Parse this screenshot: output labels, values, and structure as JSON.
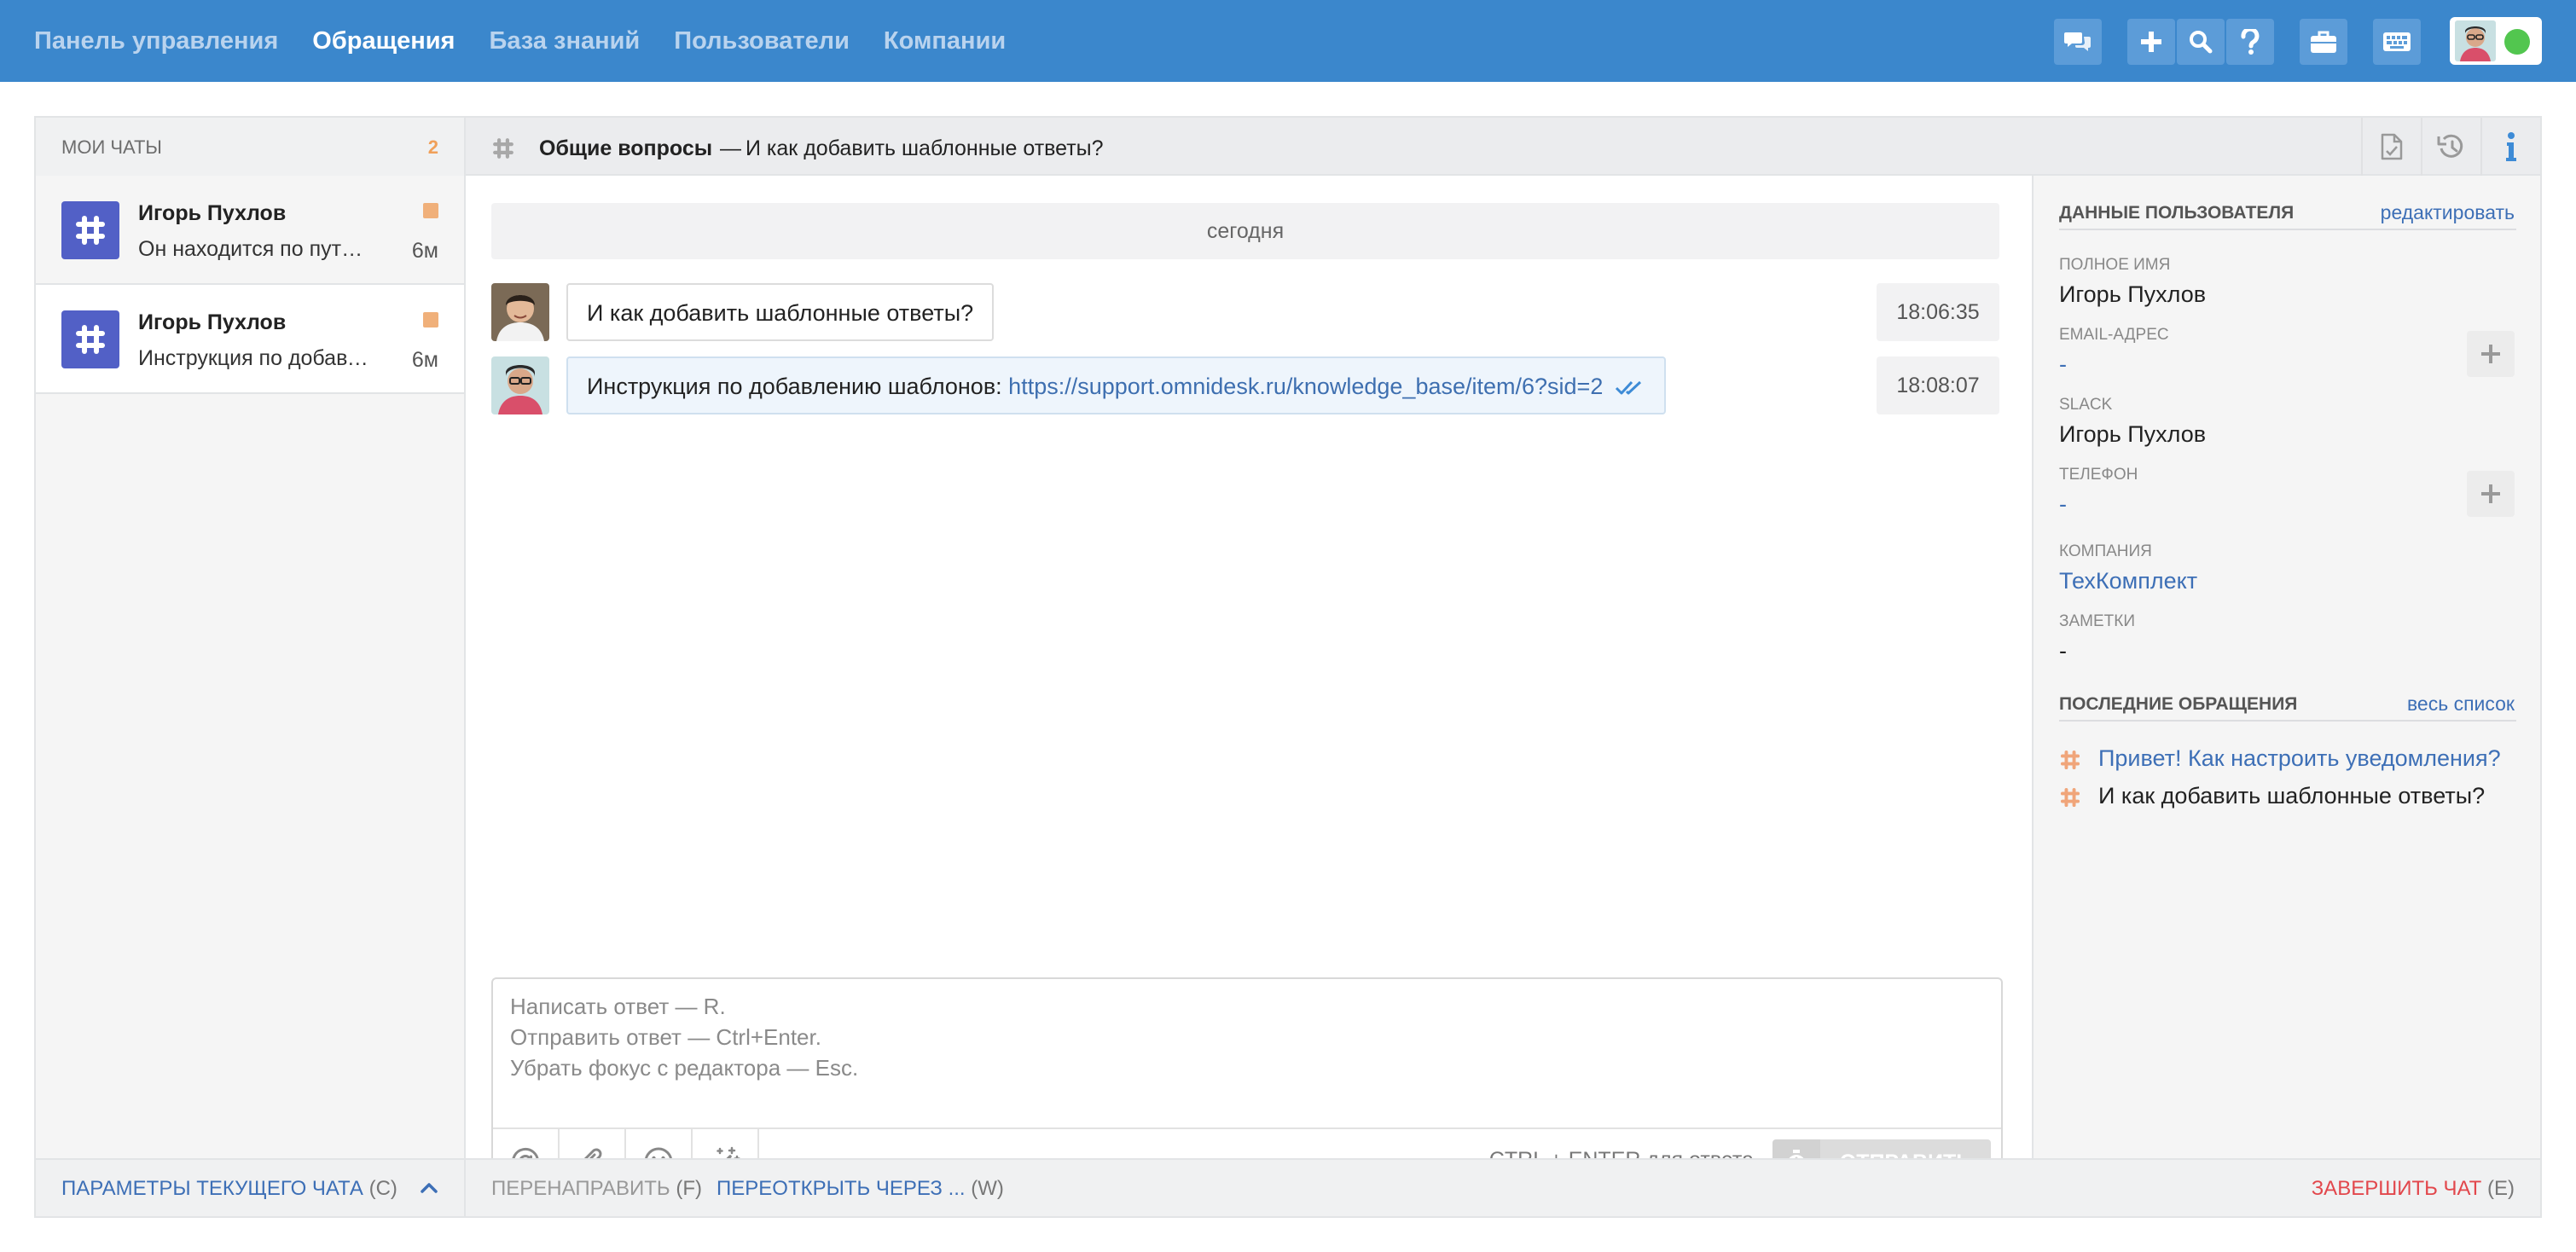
{
  "nav": {
    "items": [
      "Панель управления",
      "Обращения",
      "База знаний",
      "Пользователи",
      "Компании"
    ],
    "active_index": 1
  },
  "toolbar_icons": [
    "chat-bubbles-icon",
    "plus-icon",
    "search-icon",
    "help-icon",
    "briefcase-icon",
    "keyboard-icon"
  ],
  "user_status": "online",
  "sidebar": {
    "title": "МОИ ЧАТЫ",
    "count": "2",
    "chats": [
      {
        "name": "Игорь Пухлов",
        "snippet": "Он находится по пути: Настройки - Шаблоны",
        "time": "6м",
        "selected": false
      },
      {
        "name": "Игорь Пухлов",
        "snippet": "Инструкция по добавлению шаблонов",
        "time": "6м",
        "selected": true
      }
    ],
    "footer": {
      "label": "ПАРАМЕТРЫ ТЕКУЩЕГО ЧАТА",
      "key": "(C)"
    }
  },
  "chat_header": {
    "group": "Общие вопросы",
    "dash": "—",
    "subject": "И как добавить шаблонные ответы?"
  },
  "conversation": {
    "date_separator": "сегодня",
    "messages": [
      {
        "direction": "incoming",
        "text": "И как добавить шаблонные ответы?",
        "time": "18:06:35"
      },
      {
        "direction": "outgoing",
        "text": "Инструкция по добавлению шаблонов: ",
        "link": "https://support.omnidesk.ru/knowledge_base/item/6?sid=2",
        "time": "18:08:07",
        "read": true
      }
    ]
  },
  "composer": {
    "placeholder": "Написать ответ — R.\nОтправить ответ — Ctrl+Enter.\nУбрать фокус с редактора — Esc.",
    "hint": "CTRL + ENTER для ответа",
    "send_label": "ОТПРАВИТЬ"
  },
  "user_panel": {
    "title": "ДАННЫЕ ПОЛЬЗОВАТЕЛЯ",
    "edit_label": "редактировать",
    "fields": {
      "full_name": {
        "label": "ПОЛНОЕ ИМЯ",
        "value": "Игорь Пухлов"
      },
      "email": {
        "label": "EMAIL-АДРЕС",
        "value": "-"
      },
      "slack": {
        "label": "SLACK",
        "value": "Игорь Пухлов"
      },
      "phone": {
        "label": "ТЕЛЕФОН",
        "value": "-"
      },
      "company": {
        "label": "КОМПАНИЯ",
        "value": "ТехКомплект"
      },
      "notes": {
        "label": "ЗАМЕТКИ",
        "value": "-"
      }
    },
    "recent_title": "ПОСЛЕДНИЕ ОБРАЩЕНИЯ",
    "recent_all_label": "весь список",
    "recent": [
      {
        "title": "Привет! Как настроить уведомления?",
        "current": false
      },
      {
        "title": "И как добавить шаблонные ответы?",
        "current": true
      }
    ]
  },
  "footer_actions": {
    "forward": {
      "label": "ПЕРЕНАПРАВИТЬ",
      "key": "(F)"
    },
    "reopen": {
      "label": "ПЕРЕОТКРЫТЬ ЧЕРЕЗ ...",
      "key": "(W)"
    },
    "finish": {
      "label": "ЗАВЕРШИТЬ ЧАТ",
      "key": "(E)"
    }
  },
  "colors": {
    "topbar": "#3b87cc",
    "accent_link": "#3d6fb6",
    "danger": "#e2474c",
    "slack_icon": "#5260c6",
    "unread_flag": "#f0b07a",
    "online": "#52c64f"
  }
}
